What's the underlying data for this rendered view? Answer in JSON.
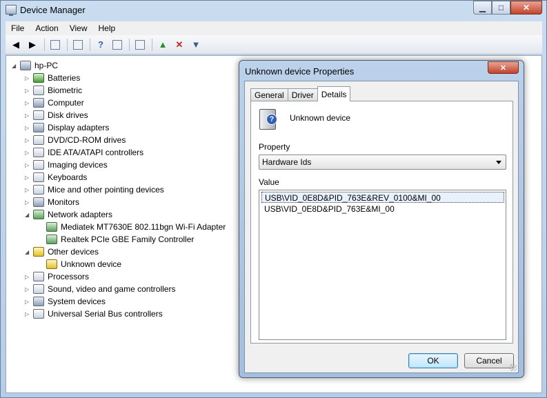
{
  "window": {
    "title": "Device Manager",
    "controls": {
      "minimize": "▁",
      "maximize": "□",
      "close": "✕"
    }
  },
  "menu": [
    "File",
    "Action",
    "View",
    "Help"
  ],
  "toolbar": [
    "back-icon",
    "forward-icon",
    "show-hide-tree-icon",
    "properties-icon",
    "help-icon",
    "view-icon",
    "scan-hardware-icon",
    "update-driver-icon",
    "uninstall-icon",
    "disable-icon"
  ],
  "tree": [
    {
      "label": "hp-PC",
      "level": 0,
      "expander": "◢",
      "icon": "pc"
    },
    {
      "label": "Batteries",
      "level": 1,
      "expander": "▷",
      "icon": "bat"
    },
    {
      "label": "Biometric",
      "level": 1,
      "expander": "▷",
      "icon": "dev"
    },
    {
      "label": "Computer",
      "level": 1,
      "expander": "▷",
      "icon": "pc"
    },
    {
      "label": "Disk drives",
      "level": 1,
      "expander": "▷",
      "icon": "dev"
    },
    {
      "label": "Display adapters",
      "level": 1,
      "expander": "▷",
      "icon": "pc"
    },
    {
      "label": "DVD/CD-ROM drives",
      "level": 1,
      "expander": "▷",
      "icon": "dev"
    },
    {
      "label": "IDE ATA/ATAPI controllers",
      "level": 1,
      "expander": "▷",
      "icon": "dev"
    },
    {
      "label": "Imaging devices",
      "level": 1,
      "expander": "▷",
      "icon": "dev"
    },
    {
      "label": "Keyboards",
      "level": 1,
      "expander": "▷",
      "icon": "dev"
    },
    {
      "label": "Mice and other pointing devices",
      "level": 1,
      "expander": "▷",
      "icon": "dev"
    },
    {
      "label": "Monitors",
      "level": 1,
      "expander": "▷",
      "icon": "pc"
    },
    {
      "label": "Network adapters",
      "level": 1,
      "expander": "◢",
      "icon": "net"
    },
    {
      "label": "Mediatek MT7630E 802.11bgn Wi-Fi Adapter",
      "level": 2,
      "expander": "",
      "icon": "net"
    },
    {
      "label": "Realtek PCIe GBE Family Controller",
      "level": 2,
      "expander": "",
      "icon": "net"
    },
    {
      "label": "Other devices",
      "level": 1,
      "expander": "◢",
      "icon": "warn"
    },
    {
      "label": "Unknown device",
      "level": 2,
      "expander": "",
      "icon": "warn"
    },
    {
      "label": "Processors",
      "level": 1,
      "expander": "▷",
      "icon": "dev"
    },
    {
      "label": "Sound, video and game controllers",
      "level": 1,
      "expander": "▷",
      "icon": "dev"
    },
    {
      "label": "System devices",
      "level": 1,
      "expander": "▷",
      "icon": "pc"
    },
    {
      "label": "Universal Serial Bus controllers",
      "level": 1,
      "expander": "▷",
      "icon": "dev"
    }
  ],
  "dialog": {
    "title": "Unknown device Properties",
    "close": "✕",
    "tabs": [
      "General",
      "Driver",
      "Details"
    ],
    "active_tab": "Details",
    "device_name": "Unknown device",
    "device_icon_glyph": "?",
    "property_label": "Property",
    "property_value": "Hardware Ids",
    "value_label": "Value",
    "values": [
      "USB\\VID_0E8D&PID_763E&REV_0100&MI_00",
      "USB\\VID_0E8D&PID_763E&MI_00"
    ],
    "ok_label": "OK",
    "cancel_label": "Cancel"
  }
}
